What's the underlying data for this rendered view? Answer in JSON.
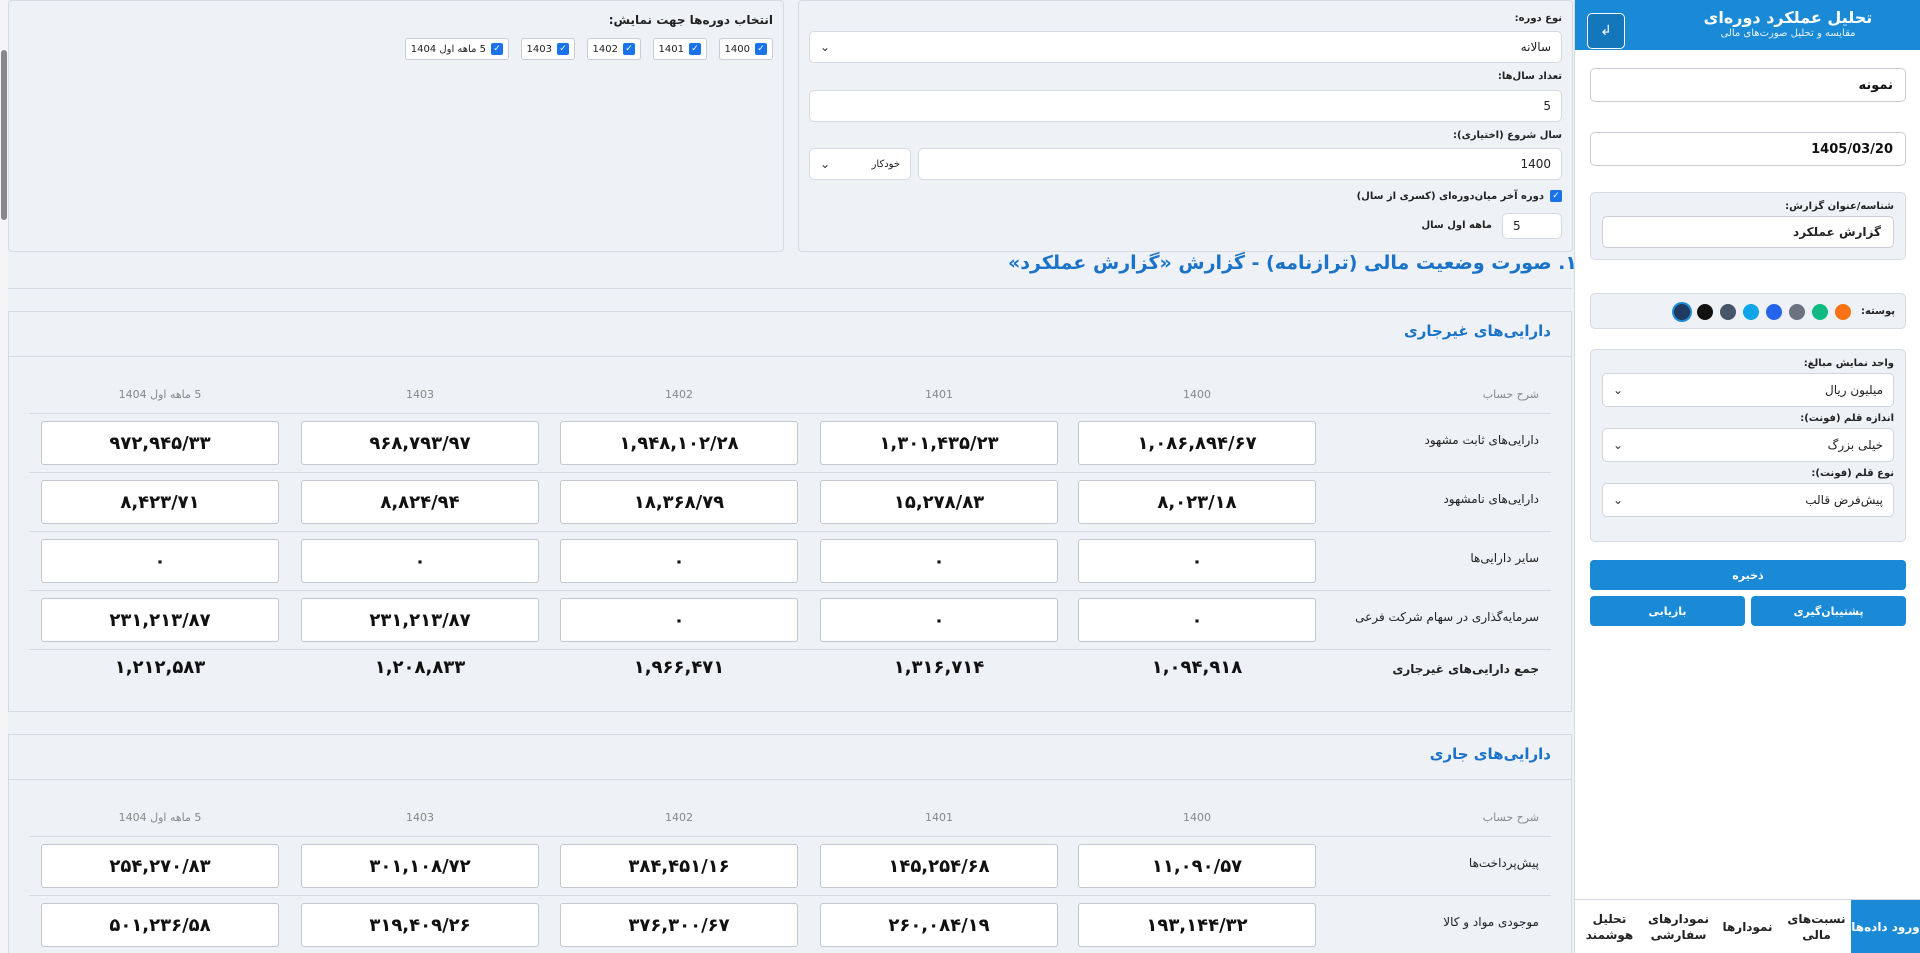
{
  "sidebar": {
    "title": "تحلیل عملکرد دوره‌ای",
    "subtitle": "مقایسه و تحلیل صورت‌های مالی",
    "company": "نمونه",
    "date": "1405/03/20",
    "report_label": "شناسه/عنوان گزارش:",
    "report_value": "گزارش عملکرد",
    "skin_label": "پوسته:",
    "skin_colors": [
      "#f97316",
      "#10b981",
      "#6b7280",
      "#2563eb",
      "#0ea5e9",
      "#475569",
      "#111111",
      "#1e3a5f"
    ],
    "unit_label": "واحد نمایش مبالغ:",
    "unit_value": "میلیون ریال",
    "font_size_label": "اندازه قلم (فونت):",
    "font_size_value": "خیلی بزرگ",
    "font_type_label": "نوع قلم (فونت):",
    "font_type_value": "پیش‌فرض قالب",
    "save": "ذخیره",
    "backup": "پشتیبان‌گیری",
    "restore": "بازیابی",
    "tabs": [
      "ورود داده‌ها",
      "نسبت‌های مالی",
      "نمودارها",
      "نمودارهای سفارشی",
      "تحلیل هوشمند"
    ]
  },
  "settings": {
    "period_type_label": "نوع دوره:",
    "period_type_value": "سالانه",
    "years_label": "تعداد سال‌ها:",
    "years_value": "5",
    "start_label": "سال شروع (اختیاری):",
    "start_value": "1400",
    "auto_value": "خودکار",
    "interim_label": "دوره آخر میان‌دوره‌ای (کسری از سال)",
    "months_value": "5",
    "months_suffix": "ماهه اول سال"
  },
  "periods_panel": {
    "title": "انتخاب دوره‌ها جهت نمایش:",
    "items": [
      "1400",
      "1401",
      "1402",
      "1403",
      "5 ماهه اول 1404"
    ]
  },
  "page_title": "۱. صورت وضعیت مالی (ترازنامه) - گزارش «گزارش عملکرد»",
  "columns": {
    "desc": "شرح حساب",
    "periods": [
      "1400",
      "1401",
      "1402",
      "1403",
      "5 ماهه اول 1404"
    ]
  },
  "noncurrent": {
    "title": "دارایی‌های غیرجاری",
    "rows": [
      {
        "label": "دارایی‌های ثابت مشهود",
        "values": [
          "۱,۰۸۶,۸۹۴/۶۷",
          "۱,۳۰۱,۴۳۵/۲۳",
          "۱,۹۴۸,۱۰۲/۲۸",
          "۹۶۸,۷۹۳/۹۷",
          "۹۷۲,۹۴۵/۳۳"
        ]
      },
      {
        "label": "دارایی‌های نامشهود",
        "values": [
          "۸,۰۲۳/۱۸",
          "۱۵,۲۷۸/۸۳",
          "۱۸,۳۶۸/۷۹",
          "۸,۸۲۴/۹۴",
          "۸,۴۲۳/۷۱"
        ]
      },
      {
        "label": "سایر دارایی‌ها",
        "values": [
          "۰",
          "۰",
          "۰",
          "۰",
          "۰"
        ]
      },
      {
        "label": "سرمایه‌گذاری در سهام شرکت فرعی",
        "values": [
          "۰",
          "۰",
          "۰",
          "۲۳۱,۲۱۳/۸۷",
          "۲۳۱,۲۱۳/۸۷"
        ]
      }
    ],
    "total_label": "جمع دارایی‌های غیرجاری",
    "totals": [
      "۱,۰۹۴,۹۱۸",
      "۱,۳۱۶,۷۱۴",
      "۱,۹۶۶,۴۷۱",
      "۱,۲۰۸,۸۳۳",
      "۱,۲۱۲,۵۸۳"
    ]
  },
  "current": {
    "title": "دارایی‌های جاری",
    "rows": [
      {
        "label": "پیش‌پرداخت‌ها",
        "values": [
          "۱۱,۰۹۰/۵۷",
          "۱۴۵,۲۵۴/۶۸",
          "۳۸۴,۴۵۱/۱۶",
          "۳۰۱,۱۰۸/۷۲",
          "۲۵۴,۲۷۰/۸۳"
        ]
      },
      {
        "label": "موجودی مواد و کالا",
        "values": [
          "۱۹۳,۱۴۴/۳۲",
          "۲۶۰,۰۸۴/۱۹",
          "۳۷۶,۳۰۰/۶۷",
          "۳۱۹,۴۰۹/۲۶",
          "۵۰۱,۲۳۶/۵۸"
        ]
      }
    ]
  }
}
